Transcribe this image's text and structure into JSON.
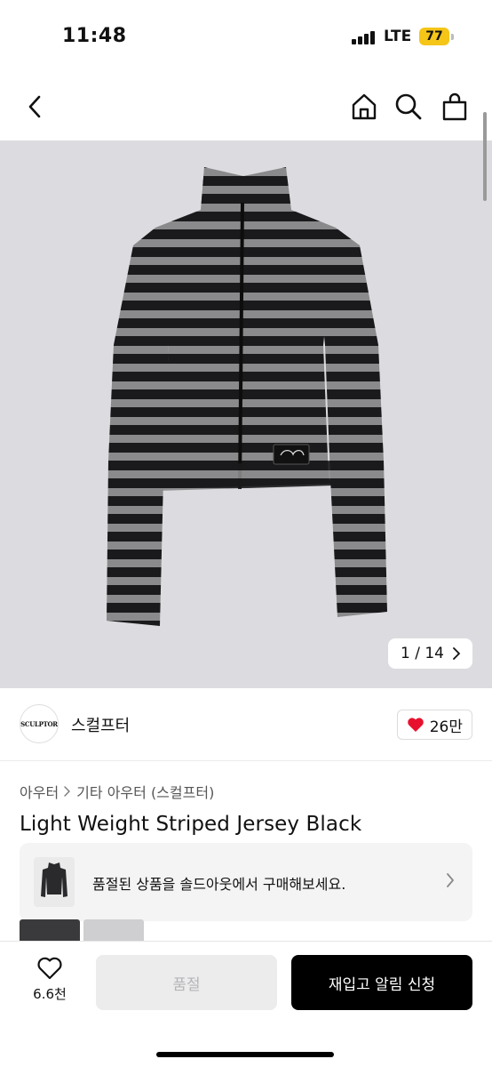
{
  "status_bar": {
    "time": "11:48",
    "network": "LTE",
    "battery": "77"
  },
  "header": {
    "back_icon": "chevron-left-icon",
    "home_icon": "home-icon",
    "search_icon": "search-icon",
    "bag_icon": "shopping-bag-icon"
  },
  "gallery": {
    "counter": "1 / 14",
    "product_image": "striped-zip-jacket"
  },
  "brand": {
    "logo_text": "SCULPTOR",
    "name": "스컬프터",
    "likes": "26만"
  },
  "breadcrumb": {
    "items": [
      "아우터",
      "기타 아우터 (스컬프터)"
    ]
  },
  "product": {
    "title": "Light Weight Striped Jersey Black"
  },
  "soldout_banner": {
    "text": "품절된 상품을 솔드아웃에서 구매해보세요."
  },
  "bottom_bar": {
    "wish_count": "6.6천",
    "soldout_label": "품절",
    "restock_label": "재입고 알림 신청"
  },
  "colors": {
    "accent": "#000000",
    "heart": "#e8112d",
    "battery": "#f5c518",
    "hero_bg": "#dcdce0"
  }
}
